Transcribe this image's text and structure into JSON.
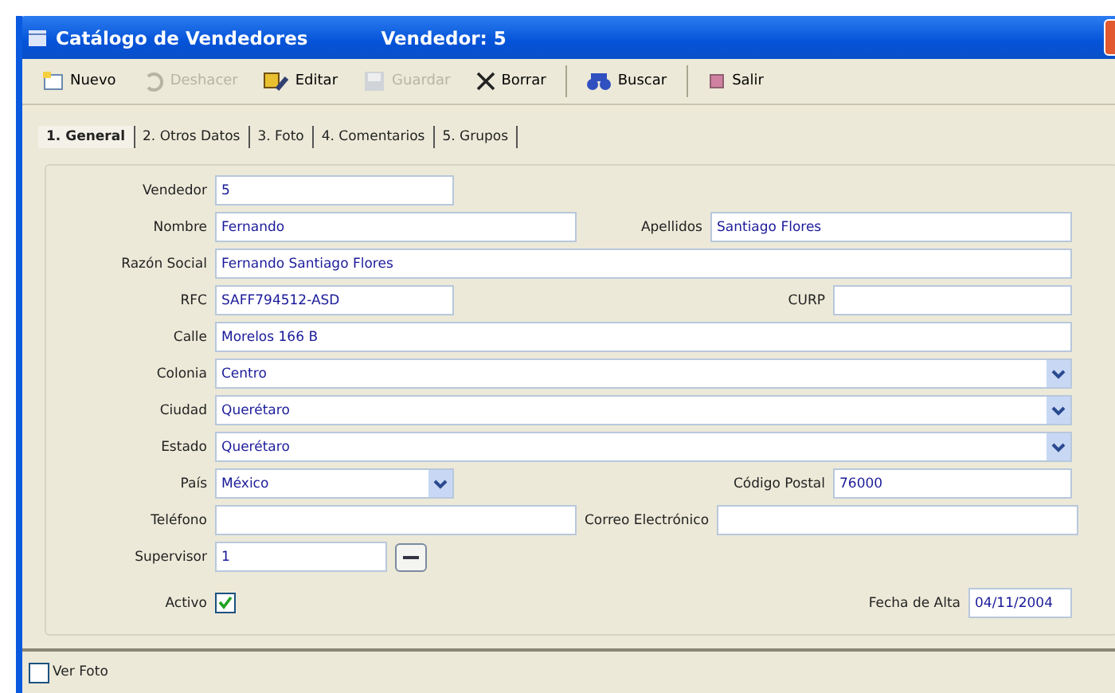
{
  "window": {
    "title": "Catálogo de Vendedores",
    "subtitle": "Vendedor: 5"
  },
  "toolbar": [
    {
      "kind": "new",
      "label": "Nuevo",
      "disabled": false
    },
    {
      "kind": "undo",
      "label": "Deshacer",
      "disabled": true
    },
    {
      "kind": "edit",
      "label": "Editar",
      "disabled": false
    },
    {
      "kind": "save",
      "label": "Guardar",
      "disabled": true
    },
    {
      "kind": "delete",
      "label": "Borrar",
      "disabled": false
    },
    {
      "kind": "search",
      "label": "Buscar",
      "disabled": false
    },
    {
      "kind": "exit",
      "label": "Salir",
      "disabled": false
    }
  ],
  "tabs": [
    {
      "label": "1. General",
      "selected": true
    },
    {
      "label": "2. Otros Datos",
      "selected": false
    },
    {
      "label": "3. Foto",
      "selected": false
    },
    {
      "label": "4. Comentarios",
      "selected": false
    },
    {
      "label": "5. Grupos",
      "selected": false
    }
  ],
  "rows": [
    {
      "kind": "short",
      "fields": [
        {
          "label": "Vendedor",
          "kind": "text",
          "value": "5"
        }
      ]
    },
    {
      "kind": "split_wide",
      "fields": [
        {
          "label": "Nombre",
          "kind": "text",
          "value": "Fernando"
        },
        {
          "label": "Apellidos",
          "kind": "text",
          "value": "Santiago Flores"
        }
      ]
    },
    {
      "kind": "full",
      "fields": [
        {
          "label": "Razón Social",
          "kind": "text",
          "value": "Fernando Santiago Flores"
        }
      ]
    },
    {
      "kind": "split",
      "fields": [
        {
          "label": "RFC",
          "kind": "text",
          "value": "SAFF794512-ASD"
        },
        {
          "label": "CURP",
          "kind": "text"
        }
      ]
    },
    {
      "kind": "full",
      "fields": [
        {
          "label": "Calle",
          "kind": "text",
          "value": "Morelos 166 B"
        }
      ]
    },
    {
      "kind": "full",
      "fields": [
        {
          "label": "Colonia",
          "kind": "combo",
          "value": "Centro"
        }
      ]
    },
    {
      "kind": "full",
      "fields": [
        {
          "label": "Ciudad",
          "kind": "combo",
          "value": "Querétaro"
        }
      ]
    },
    {
      "kind": "full",
      "fields": [
        {
          "label": "Estado",
          "kind": "combo",
          "value": "Querétaro"
        }
      ]
    },
    {
      "kind": "split",
      "fields": [
        {
          "label": "País",
          "kind": "combo",
          "value": "México"
        },
        {
          "label": "Código Postal",
          "kind": "text",
          "value": "76000"
        }
      ]
    },
    {
      "kind": "split_wide",
      "fields": [
        {
          "label": "Teléfono",
          "kind": "text"
        },
        {
          "label": "Correo Electrónico",
          "kind": "text"
        }
      ]
    },
    {
      "kind": "lookup",
      "fields": [
        {
          "label": "Supervisor",
          "kind": "lookup",
          "value": "1"
        }
      ]
    },
    {
      "kind": "split_date",
      "fields": [
        {
          "label": "Activo",
          "kind": "checkbox",
          "checked": true
        },
        {
          "label": "Fecha de Alta",
          "kind": "date",
          "value": "04/11/2004"
        }
      ]
    }
  ],
  "footer": {
    "label": "Ver Foto",
    "checked": false
  }
}
